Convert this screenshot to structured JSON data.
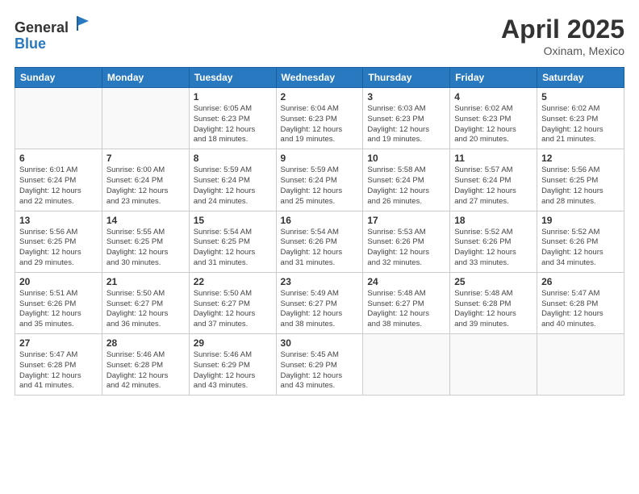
{
  "header": {
    "logo_general": "General",
    "logo_blue": "Blue",
    "title": "April 2025",
    "location": "Oxinam, Mexico"
  },
  "weekdays": [
    "Sunday",
    "Monday",
    "Tuesday",
    "Wednesday",
    "Thursday",
    "Friday",
    "Saturday"
  ],
  "weeks": [
    [
      {
        "day": "",
        "info": ""
      },
      {
        "day": "",
        "info": ""
      },
      {
        "day": "1",
        "info": "Sunrise: 6:05 AM\nSunset: 6:23 PM\nDaylight: 12 hours\nand 18 minutes."
      },
      {
        "day": "2",
        "info": "Sunrise: 6:04 AM\nSunset: 6:23 PM\nDaylight: 12 hours\nand 19 minutes."
      },
      {
        "day": "3",
        "info": "Sunrise: 6:03 AM\nSunset: 6:23 PM\nDaylight: 12 hours\nand 19 minutes."
      },
      {
        "day": "4",
        "info": "Sunrise: 6:02 AM\nSunset: 6:23 PM\nDaylight: 12 hours\nand 20 minutes."
      },
      {
        "day": "5",
        "info": "Sunrise: 6:02 AM\nSunset: 6:23 PM\nDaylight: 12 hours\nand 21 minutes."
      }
    ],
    [
      {
        "day": "6",
        "info": "Sunrise: 6:01 AM\nSunset: 6:24 PM\nDaylight: 12 hours\nand 22 minutes."
      },
      {
        "day": "7",
        "info": "Sunrise: 6:00 AM\nSunset: 6:24 PM\nDaylight: 12 hours\nand 23 minutes."
      },
      {
        "day": "8",
        "info": "Sunrise: 5:59 AM\nSunset: 6:24 PM\nDaylight: 12 hours\nand 24 minutes."
      },
      {
        "day": "9",
        "info": "Sunrise: 5:59 AM\nSunset: 6:24 PM\nDaylight: 12 hours\nand 25 minutes."
      },
      {
        "day": "10",
        "info": "Sunrise: 5:58 AM\nSunset: 6:24 PM\nDaylight: 12 hours\nand 26 minutes."
      },
      {
        "day": "11",
        "info": "Sunrise: 5:57 AM\nSunset: 6:24 PM\nDaylight: 12 hours\nand 27 minutes."
      },
      {
        "day": "12",
        "info": "Sunrise: 5:56 AM\nSunset: 6:25 PM\nDaylight: 12 hours\nand 28 minutes."
      }
    ],
    [
      {
        "day": "13",
        "info": "Sunrise: 5:56 AM\nSunset: 6:25 PM\nDaylight: 12 hours\nand 29 minutes."
      },
      {
        "day": "14",
        "info": "Sunrise: 5:55 AM\nSunset: 6:25 PM\nDaylight: 12 hours\nand 30 minutes."
      },
      {
        "day": "15",
        "info": "Sunrise: 5:54 AM\nSunset: 6:25 PM\nDaylight: 12 hours\nand 31 minutes."
      },
      {
        "day": "16",
        "info": "Sunrise: 5:54 AM\nSunset: 6:26 PM\nDaylight: 12 hours\nand 31 minutes."
      },
      {
        "day": "17",
        "info": "Sunrise: 5:53 AM\nSunset: 6:26 PM\nDaylight: 12 hours\nand 32 minutes."
      },
      {
        "day": "18",
        "info": "Sunrise: 5:52 AM\nSunset: 6:26 PM\nDaylight: 12 hours\nand 33 minutes."
      },
      {
        "day": "19",
        "info": "Sunrise: 5:52 AM\nSunset: 6:26 PM\nDaylight: 12 hours\nand 34 minutes."
      }
    ],
    [
      {
        "day": "20",
        "info": "Sunrise: 5:51 AM\nSunset: 6:26 PM\nDaylight: 12 hours\nand 35 minutes."
      },
      {
        "day": "21",
        "info": "Sunrise: 5:50 AM\nSunset: 6:27 PM\nDaylight: 12 hours\nand 36 minutes."
      },
      {
        "day": "22",
        "info": "Sunrise: 5:50 AM\nSunset: 6:27 PM\nDaylight: 12 hours\nand 37 minutes."
      },
      {
        "day": "23",
        "info": "Sunrise: 5:49 AM\nSunset: 6:27 PM\nDaylight: 12 hours\nand 38 minutes."
      },
      {
        "day": "24",
        "info": "Sunrise: 5:48 AM\nSunset: 6:27 PM\nDaylight: 12 hours\nand 38 minutes."
      },
      {
        "day": "25",
        "info": "Sunrise: 5:48 AM\nSunset: 6:28 PM\nDaylight: 12 hours\nand 39 minutes."
      },
      {
        "day": "26",
        "info": "Sunrise: 5:47 AM\nSunset: 6:28 PM\nDaylight: 12 hours\nand 40 minutes."
      }
    ],
    [
      {
        "day": "27",
        "info": "Sunrise: 5:47 AM\nSunset: 6:28 PM\nDaylight: 12 hours\nand 41 minutes."
      },
      {
        "day": "28",
        "info": "Sunrise: 5:46 AM\nSunset: 6:28 PM\nDaylight: 12 hours\nand 42 minutes."
      },
      {
        "day": "29",
        "info": "Sunrise: 5:46 AM\nSunset: 6:29 PM\nDaylight: 12 hours\nand 43 minutes."
      },
      {
        "day": "30",
        "info": "Sunrise: 5:45 AM\nSunset: 6:29 PM\nDaylight: 12 hours\nand 43 minutes."
      },
      {
        "day": "",
        "info": ""
      },
      {
        "day": "",
        "info": ""
      },
      {
        "day": "",
        "info": ""
      }
    ]
  ]
}
